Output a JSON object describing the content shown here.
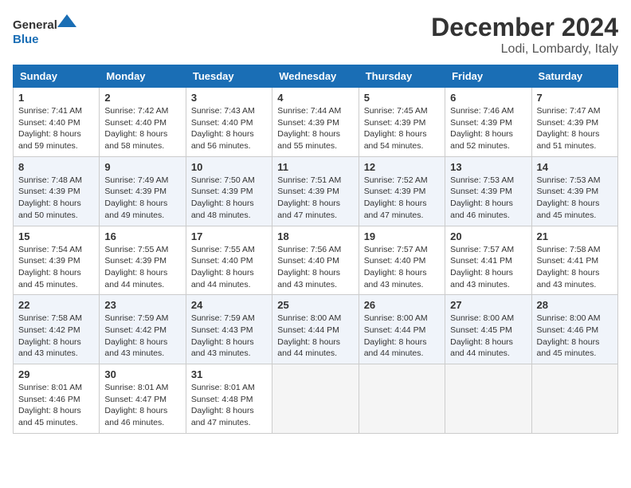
{
  "header": {
    "logo_general": "General",
    "logo_blue": "Blue",
    "title": "December 2024",
    "subtitle": "Lodi, Lombardy, Italy"
  },
  "columns": [
    "Sunday",
    "Monday",
    "Tuesday",
    "Wednesday",
    "Thursday",
    "Friday",
    "Saturday"
  ],
  "weeks": [
    [
      {
        "day": "1",
        "sunrise": "Sunrise: 7:41 AM",
        "sunset": "Sunset: 4:40 PM",
        "daylight": "Daylight: 8 hours and 59 minutes."
      },
      {
        "day": "2",
        "sunrise": "Sunrise: 7:42 AM",
        "sunset": "Sunset: 4:40 PM",
        "daylight": "Daylight: 8 hours and 58 minutes."
      },
      {
        "day": "3",
        "sunrise": "Sunrise: 7:43 AM",
        "sunset": "Sunset: 4:40 PM",
        "daylight": "Daylight: 8 hours and 56 minutes."
      },
      {
        "day": "4",
        "sunrise": "Sunrise: 7:44 AM",
        "sunset": "Sunset: 4:39 PM",
        "daylight": "Daylight: 8 hours and 55 minutes."
      },
      {
        "day": "5",
        "sunrise": "Sunrise: 7:45 AM",
        "sunset": "Sunset: 4:39 PM",
        "daylight": "Daylight: 8 hours and 54 minutes."
      },
      {
        "day": "6",
        "sunrise": "Sunrise: 7:46 AM",
        "sunset": "Sunset: 4:39 PM",
        "daylight": "Daylight: 8 hours and 52 minutes."
      },
      {
        "day": "7",
        "sunrise": "Sunrise: 7:47 AM",
        "sunset": "Sunset: 4:39 PM",
        "daylight": "Daylight: 8 hours and 51 minutes."
      }
    ],
    [
      {
        "day": "8",
        "sunrise": "Sunrise: 7:48 AM",
        "sunset": "Sunset: 4:39 PM",
        "daylight": "Daylight: 8 hours and 50 minutes."
      },
      {
        "day": "9",
        "sunrise": "Sunrise: 7:49 AM",
        "sunset": "Sunset: 4:39 PM",
        "daylight": "Daylight: 8 hours and 49 minutes."
      },
      {
        "day": "10",
        "sunrise": "Sunrise: 7:50 AM",
        "sunset": "Sunset: 4:39 PM",
        "daylight": "Daylight: 8 hours and 48 minutes."
      },
      {
        "day": "11",
        "sunrise": "Sunrise: 7:51 AM",
        "sunset": "Sunset: 4:39 PM",
        "daylight": "Daylight: 8 hours and 47 minutes."
      },
      {
        "day": "12",
        "sunrise": "Sunrise: 7:52 AM",
        "sunset": "Sunset: 4:39 PM",
        "daylight": "Daylight: 8 hours and 47 minutes."
      },
      {
        "day": "13",
        "sunrise": "Sunrise: 7:53 AM",
        "sunset": "Sunset: 4:39 PM",
        "daylight": "Daylight: 8 hours and 46 minutes."
      },
      {
        "day": "14",
        "sunrise": "Sunrise: 7:53 AM",
        "sunset": "Sunset: 4:39 PM",
        "daylight": "Daylight: 8 hours and 45 minutes."
      }
    ],
    [
      {
        "day": "15",
        "sunrise": "Sunrise: 7:54 AM",
        "sunset": "Sunset: 4:39 PM",
        "daylight": "Daylight: 8 hours and 45 minutes."
      },
      {
        "day": "16",
        "sunrise": "Sunrise: 7:55 AM",
        "sunset": "Sunset: 4:39 PM",
        "daylight": "Daylight: 8 hours and 44 minutes."
      },
      {
        "day": "17",
        "sunrise": "Sunrise: 7:55 AM",
        "sunset": "Sunset: 4:40 PM",
        "daylight": "Daylight: 8 hours and 44 minutes."
      },
      {
        "day": "18",
        "sunrise": "Sunrise: 7:56 AM",
        "sunset": "Sunset: 4:40 PM",
        "daylight": "Daylight: 8 hours and 43 minutes."
      },
      {
        "day": "19",
        "sunrise": "Sunrise: 7:57 AM",
        "sunset": "Sunset: 4:40 PM",
        "daylight": "Daylight: 8 hours and 43 minutes."
      },
      {
        "day": "20",
        "sunrise": "Sunrise: 7:57 AM",
        "sunset": "Sunset: 4:41 PM",
        "daylight": "Daylight: 8 hours and 43 minutes."
      },
      {
        "day": "21",
        "sunrise": "Sunrise: 7:58 AM",
        "sunset": "Sunset: 4:41 PM",
        "daylight": "Daylight: 8 hours and 43 minutes."
      }
    ],
    [
      {
        "day": "22",
        "sunrise": "Sunrise: 7:58 AM",
        "sunset": "Sunset: 4:42 PM",
        "daylight": "Daylight: 8 hours and 43 minutes."
      },
      {
        "day": "23",
        "sunrise": "Sunrise: 7:59 AM",
        "sunset": "Sunset: 4:42 PM",
        "daylight": "Daylight: 8 hours and 43 minutes."
      },
      {
        "day": "24",
        "sunrise": "Sunrise: 7:59 AM",
        "sunset": "Sunset: 4:43 PM",
        "daylight": "Daylight: 8 hours and 43 minutes."
      },
      {
        "day": "25",
        "sunrise": "Sunrise: 8:00 AM",
        "sunset": "Sunset: 4:44 PM",
        "daylight": "Daylight: 8 hours and 44 minutes."
      },
      {
        "day": "26",
        "sunrise": "Sunrise: 8:00 AM",
        "sunset": "Sunset: 4:44 PM",
        "daylight": "Daylight: 8 hours and 44 minutes."
      },
      {
        "day": "27",
        "sunrise": "Sunrise: 8:00 AM",
        "sunset": "Sunset: 4:45 PM",
        "daylight": "Daylight: 8 hours and 44 minutes."
      },
      {
        "day": "28",
        "sunrise": "Sunrise: 8:00 AM",
        "sunset": "Sunset: 4:46 PM",
        "daylight": "Daylight: 8 hours and 45 minutes."
      }
    ],
    [
      {
        "day": "29",
        "sunrise": "Sunrise: 8:01 AM",
        "sunset": "Sunset: 4:46 PM",
        "daylight": "Daylight: 8 hours and 45 minutes."
      },
      {
        "day": "30",
        "sunrise": "Sunrise: 8:01 AM",
        "sunset": "Sunset: 4:47 PM",
        "daylight": "Daylight: 8 hours and 46 minutes."
      },
      {
        "day": "31",
        "sunrise": "Sunrise: 8:01 AM",
        "sunset": "Sunset: 4:48 PM",
        "daylight": "Daylight: 8 hours and 47 minutes."
      },
      null,
      null,
      null,
      null
    ]
  ]
}
